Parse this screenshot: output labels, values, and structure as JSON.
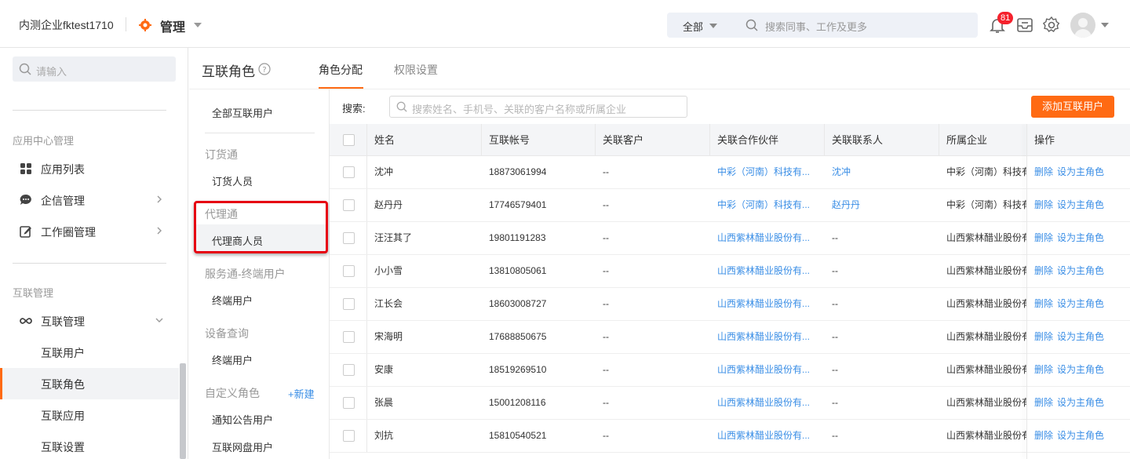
{
  "header": {
    "company": "内测企业fktest1710",
    "app_title": "管理",
    "search_scope": "全部",
    "search_placeholder": "搜索同事、工作及更多",
    "notification_count": "81"
  },
  "sidebar": {
    "search_placeholder": "请输入",
    "group1": "应用中心管理",
    "items1": [
      "应用列表",
      "企信管理",
      "工作圈管理"
    ],
    "group2": "互联管理",
    "items2": [
      "互联管理"
    ],
    "subitems": [
      "互联用户",
      "互联角色",
      "互联应用",
      "互联设置"
    ],
    "active_item": "互联角色"
  },
  "page": {
    "title": "互联角色",
    "tabs": [
      "角色分配",
      "权限设置"
    ],
    "active_tab": "角色分配"
  },
  "roles": {
    "all_users": "全部互联用户",
    "groups": [
      {
        "title": "订货通",
        "items": [
          "订货人员"
        ]
      },
      {
        "title": "代理通",
        "items": [
          "代理商人员"
        ]
      },
      {
        "title": "服务通-终端用户",
        "items": [
          "终端用户"
        ]
      },
      {
        "title": "设备查询",
        "items": [
          "终端用户"
        ]
      },
      {
        "title": "自定义角色",
        "items": [
          "通知公告用户",
          "互联网盘用户"
        ]
      }
    ],
    "new_label": "+新建",
    "selected": "代理商人员"
  },
  "search": {
    "label": "搜索:",
    "placeholder": "搜索姓名、手机号、关联的客户名称或所属企业",
    "add_button": "添加互联用户"
  },
  "table": {
    "headers": [
      "姓名",
      "互联帐号",
      "关联客户",
      "关联合作伙伴",
      "关联联系人",
      "所属企业",
      "操作"
    ],
    "actions": [
      "删除",
      "设为主角色"
    ],
    "rows": [
      {
        "name": "沈冲",
        "account": "18873061994",
        "customer": "--",
        "partner": "中彩（河南）科技有...",
        "contact": "沈冲",
        "company": "中彩（河南）科技有"
      },
      {
        "name": "赵丹丹",
        "account": "17746579401",
        "customer": "--",
        "partner": "中彩（河南）科技有...",
        "contact": "赵丹丹",
        "company": "中彩（河南）科技有"
      },
      {
        "name": "汪汪其了",
        "account": "19801191283",
        "customer": "--",
        "partner": "山西紫林醋业股份有...",
        "contact": "--",
        "company": "山西紫林醋业股份有"
      },
      {
        "name": "小小雪",
        "account": "13810805061",
        "customer": "--",
        "partner": "山西紫林醋业股份有...",
        "contact": "--",
        "company": "山西紫林醋业股份有"
      },
      {
        "name": "江长会",
        "account": "18603008727",
        "customer": "--",
        "partner": "山西紫林醋业股份有...",
        "contact": "--",
        "company": "山西紫林醋业股份有"
      },
      {
        "name": "宋海明",
        "account": "17688850675",
        "customer": "--",
        "partner": "山西紫林醋业股份有...",
        "contact": "--",
        "company": "山西紫林醋业股份有"
      },
      {
        "name": "安康",
        "account": "18519269510",
        "customer": "--",
        "partner": "山西紫林醋业股份有...",
        "contact": "--",
        "company": "山西紫林醋业股份有"
      },
      {
        "name": "张晨",
        "account": "15001208116",
        "customer": "--",
        "partner": "山西紫林醋业股份有...",
        "contact": "--",
        "company": "山西紫林醋业股份有"
      },
      {
        "name": "刘抗",
        "account": "15810540521",
        "customer": "--",
        "partner": "山西紫林醋业股份有...",
        "contact": "--",
        "company": "山西紫林醋业股份有"
      }
    ]
  },
  "colors": {
    "accent": "#ff6a13",
    "link": "#3a8ee6",
    "highlight": "#e60012"
  }
}
